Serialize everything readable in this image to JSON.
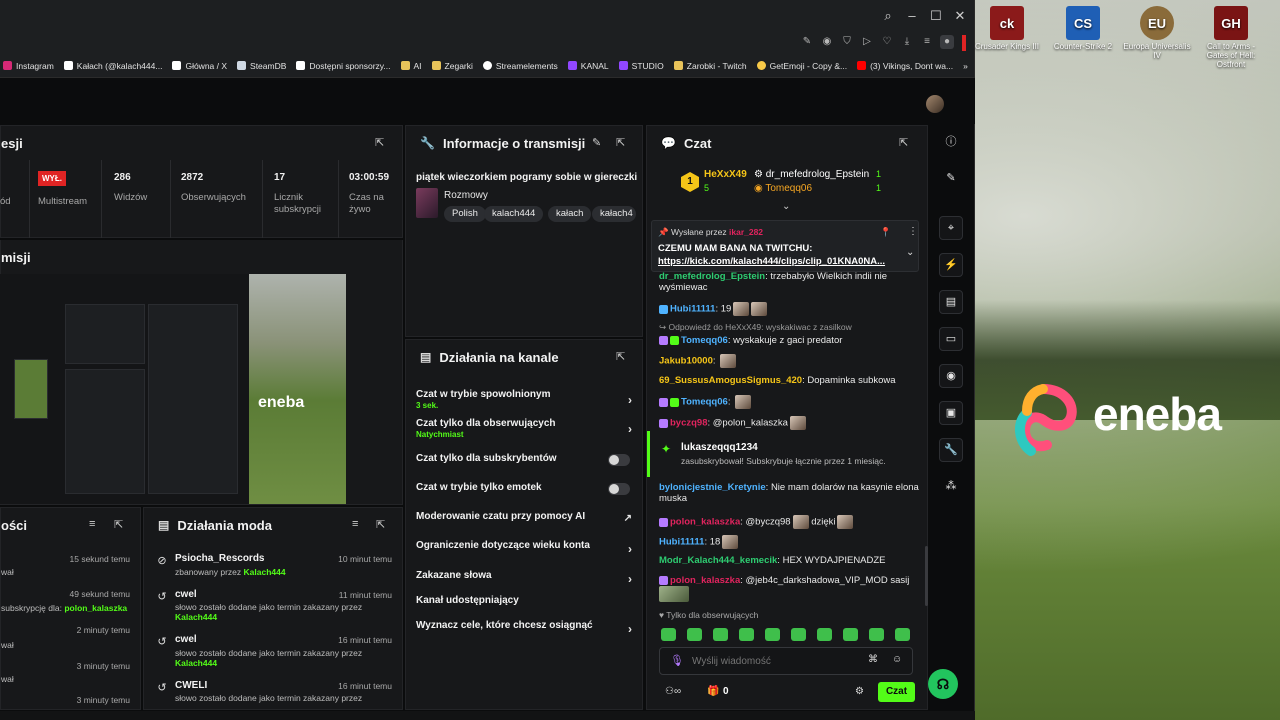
{
  "desktop": {
    "icons": [
      {
        "label": "Crusader Kings III",
        "color": "#8b1a1a",
        "glyph": "ck"
      },
      {
        "label": "Counter-Strike 2",
        "color": "#1f5fb5",
        "glyph": "CS"
      },
      {
        "label": "Europa Universalis IV",
        "color": "#8a6b3a",
        "glyph": "EU"
      },
      {
        "label": "Call to Arms - Gates of Hell: Ostfront",
        "color": "#7a1414",
        "glyph": "GH"
      }
    ],
    "eneba_word": "eneba"
  },
  "browser": {
    "bookmarks": [
      {
        "label": "Instagram",
        "color": "#d62976"
      },
      {
        "label": "Kałach (@kalach444...",
        "color": "#ffffff"
      },
      {
        "label": "Główna / X",
        "color": "#ffffff"
      },
      {
        "label": "SteamDB",
        "color": "#cfd8e3"
      },
      {
        "label": "Dostępni sponsorzy...",
        "color": "#ffffff"
      },
      {
        "label": "AI",
        "color": "#e8c35a"
      },
      {
        "label": "Zegarki",
        "color": "#e8c35a"
      },
      {
        "label": "Streamelements",
        "color": "#ffffff"
      },
      {
        "label": "KANAL",
        "color": "#9147ff"
      },
      {
        "label": "STUDIO",
        "color": "#9147ff"
      },
      {
        "label": "Zarobki - Twitch",
        "color": "#e8c35a"
      },
      {
        "label": "GetEmoji - Copy &...",
        "color": "#f7c948"
      },
      {
        "label": "(3) Vikings, Dont wa...",
        "color": "#ff0000"
      }
    ]
  },
  "session": {
    "title": "esji",
    "stat_left_label": "ód",
    "multistream_badge": "WYŁ.",
    "multistream_label": "Multistream",
    "viewers_value": "286",
    "viewers_label": "Widzów",
    "followers_value": "2872",
    "followers_label": "Obserwujących",
    "subs_value": "17",
    "subs_label": "Licznik subskrypcji",
    "time_value": "03:00:59",
    "time_label": "Czas na żywo",
    "preview_title": "misji",
    "preview_logo": "eneba"
  },
  "stream_info": {
    "title": "Informacje o transmisji",
    "stream_title": "piątek wieczorkiem pogramy sobie w giereczki",
    "category": "Rozmowy",
    "tags": [
      "Polish",
      "kalach444",
      "kałach",
      "kałach4"
    ]
  },
  "channel_actions": {
    "title": "Działania na kanale",
    "rows": [
      {
        "label": "Czat w trybie spowolnionym",
        "sub": "3 sek."
      },
      {
        "label": "Czat tylko dla obserwujących",
        "sub": "Natychmiast"
      },
      {
        "label": "Czat tylko dla subskrybentów",
        "sub": ""
      },
      {
        "label": "Czat w trybie tylko emotek",
        "sub": ""
      },
      {
        "label": "Moderowanie czatu przy pomocy AI",
        "sub": ""
      },
      {
        "label": "Ograniczenie dotyczące wieku konta",
        "sub": ""
      },
      {
        "label": "Zakazane słowa",
        "sub": ""
      },
      {
        "label": "Kanał udostępniający",
        "sub": ""
      },
      {
        "label": "Wyznacz cele, które chcesz osiągnąć",
        "sub": ""
      }
    ]
  },
  "activity": {
    "title": "ości",
    "items": [
      {
        "text": "",
        "time": "15 sekund temu"
      },
      {
        "text": "wał",
        "time": ""
      },
      {
        "text": "",
        "time": "49 sekund temu"
      },
      {
        "text": "subskrypcję dla:",
        "highlight": "polon_kalaszka",
        "time": ""
      },
      {
        "text": "",
        "time": "2 minuty temu"
      },
      {
        "text": "wał",
        "time": ""
      },
      {
        "text": "",
        "time": "3 minuty temu"
      },
      {
        "text": "wał",
        "time": ""
      },
      {
        "text": "",
        "time": "3 minuty temu"
      },
      {
        "text": "kanał",
        "time": ""
      }
    ]
  },
  "mod_actions": {
    "title": "Działania moda",
    "items": [
      {
        "title": "Psiocha_Rescords",
        "desc": "zbanowany przez",
        "by": "Kalach444",
        "time": "10 minut temu",
        "icon": "ban-icon"
      },
      {
        "title": "cwel",
        "desc": "słowo zostało dodane jako termin zakazany przez",
        "by": "Kalach444",
        "time": "11 minut temu",
        "icon": "history-icon"
      },
      {
        "title": "cwel",
        "desc": "słowo zostało dodane jako termin zakazany przez",
        "by": "Kalach444",
        "time": "16 minut temu",
        "icon": "history-icon"
      },
      {
        "title": "CWELI",
        "desc": "słowo zostało dodane jako termin zakazany przez",
        "by": "",
        "time": "16 minut temu",
        "icon": "history-icon"
      }
    ]
  },
  "chat": {
    "title": "Czat",
    "top_users": [
      {
        "name": "HeXxX49",
        "count": "5",
        "color": "#f5c518"
      },
      {
        "name": "dr_mefedrolog_Epstein",
        "count": "1",
        "color": "#ffffff"
      },
      {
        "name": "Tomeqq06",
        "count": "1",
        "color": "#f5a623"
      }
    ],
    "pinned_by_label": "Wysłane przez",
    "pinned_by": "ikar_282",
    "pinned_text": "CZEMU MAM BANA NA TWITCHU:",
    "pinned_link": "https://kick.com/kalach444/clips/clip_01KNA0NA...",
    "messages": [
      {
        "user": "dr_mefedrolog_Epstein",
        "color": "#2ecc71",
        "text": "trzebabyło Wielkich indii nie wyśmiewac"
      },
      {
        "user": "Hubi11111",
        "color": "#4fb3ff",
        "text": "19"
      },
      {
        "reply": "Odpowiedź do HeXxX49: wyskakiwac z zasilkow"
      },
      {
        "user": "Tomeqq06",
        "color": "#4fb3ff",
        "text": "wyskakuje z gaci predator"
      },
      {
        "user": "Jakub10000",
        "color": "#f5c518",
        "text": ""
      },
      {
        "user": "69_SussusAmogusSigmus_420",
        "color": "#f5c518",
        "text": "Dopaminka subkowa"
      },
      {
        "user": "Tomeqq06",
        "color": "#4fb3ff",
        "text": ""
      },
      {
        "user": "byczq98",
        "color": "#e0245e",
        "text": "@polon_kalaszka"
      },
      {
        "user": "lukaszeqqq1234",
        "color": "#ffffff",
        "text": "zasubskrybował! Subskrybuje łącznie przez 1 miesiąc."
      },
      {
        "user": "bylonicjestnie_Kretynie",
        "color": "#4fb3ff",
        "text": "Nie mam dolarów na kasynie elona muska"
      },
      {
        "user": "polon_kalaszka",
        "color": "#e0245e",
        "text": "@byczq98"
      },
      {
        "text_after": "dzięki"
      },
      {
        "user": "Hubi11111",
        "color": "#4fb3ff",
        "text": "18"
      },
      {
        "user": "Modr_Kalach444_kemecik",
        "color": "#2ecc71",
        "text": "HEX WYDAJPIENADZE"
      },
      {
        "user": "polon_kalaszka",
        "color": "#e0245e",
        "text": "@jeb4c_darkshadowa_VIP_MOD sasij"
      }
    ],
    "followers_only": "Tylko dla obserwujących",
    "input_placeholder": "Wyślij wiadomość",
    "slowmode": "0",
    "send_label": "Czat"
  }
}
